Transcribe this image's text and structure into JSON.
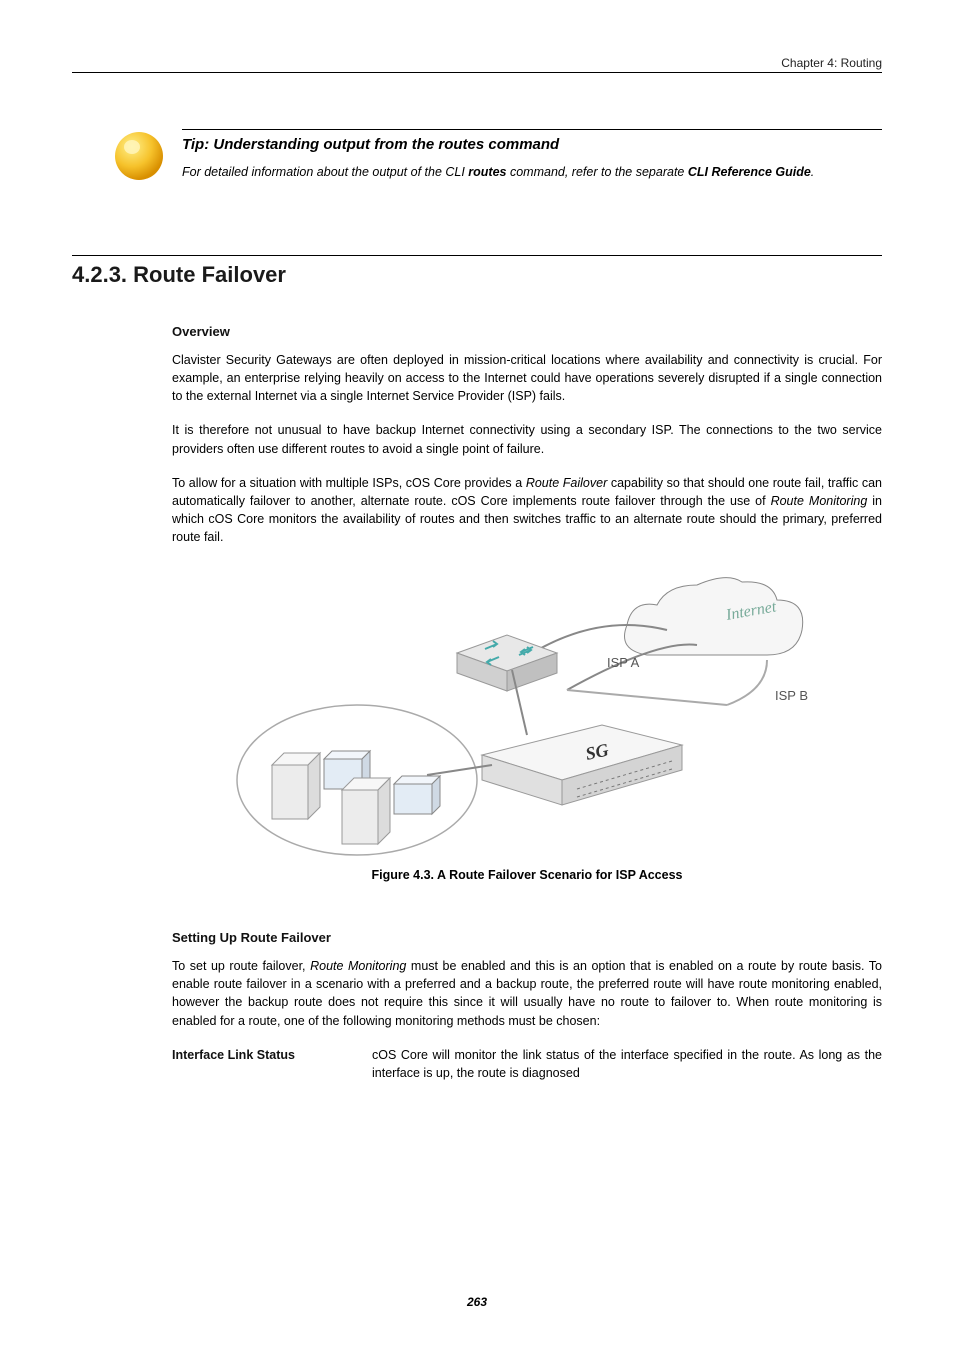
{
  "header": {
    "chapter": "Chapter 4: Routing"
  },
  "tip": {
    "title": "Tip: Understanding output from the routes command",
    "body_prefix": "For detailed information about the output of the CLI ",
    "routes_cmd": "routes",
    "body_mid": " command, refer to the separate ",
    "cli_guide": "CLI Reference Guide",
    "body_suffix": "."
  },
  "section": {
    "number": "4.2.3.",
    "title": "Route Failover"
  },
  "overview": {
    "heading": "Overview",
    "p1": "Clavister Security Gateways are often deployed in mission-critical locations where availability and connectivity is crucial. For example, an enterprise relying heavily on access to the Internet could have operations severely disrupted if a single connection to the external Internet via a single Internet Service Provider (ISP) fails.",
    "p2": "It is therefore not unusual to have backup Internet connectivity using a secondary ISP. The connections to the two service providers often use different routes to avoid a single point of failure.",
    "p3_a": "To allow for a situation with multiple ISPs, cOS Core provides a ",
    "p3_rf": "Route Failover",
    "p3_b": " capability so that should one route fail, traffic can automatically failover to another, alternate route. cOS Core implements route failover through the use of ",
    "p3_rm": "Route Monitoring",
    "p3_c": " in which cOS Core monitors the availability of routes and then switches traffic to an alternate route should the primary, preferred route fail."
  },
  "figure": {
    "caption": "Figure 4.3. A Route Failover Scenario for ISP Access",
    "labels": {
      "ispA": "ISP A",
      "ispB": "ISP B",
      "sg": "SG",
      "internet": "Internet"
    }
  },
  "setting_up": {
    "heading": "Setting Up Route Failover",
    "p1_a": "To set up route failover, ",
    "p1_rm": "Route Monitoring",
    "p1_b": " must be enabled and this is an option that is enabled on a route by route basis. To enable route failover in a scenario with a preferred and a backup route, the preferred route will have route monitoring enabled, however the backup route does not require this since it will usually have no route to failover to. When route monitoring is enabled for a route, one of the following monitoring methods must be chosen:"
  },
  "deflist": {
    "term1": "Interface Link Status",
    "desc1": "cOS Core will monitor the link status of the interface specified in the route. As long as the interface is up, the route is diagnosed"
  },
  "page_number": "263"
}
